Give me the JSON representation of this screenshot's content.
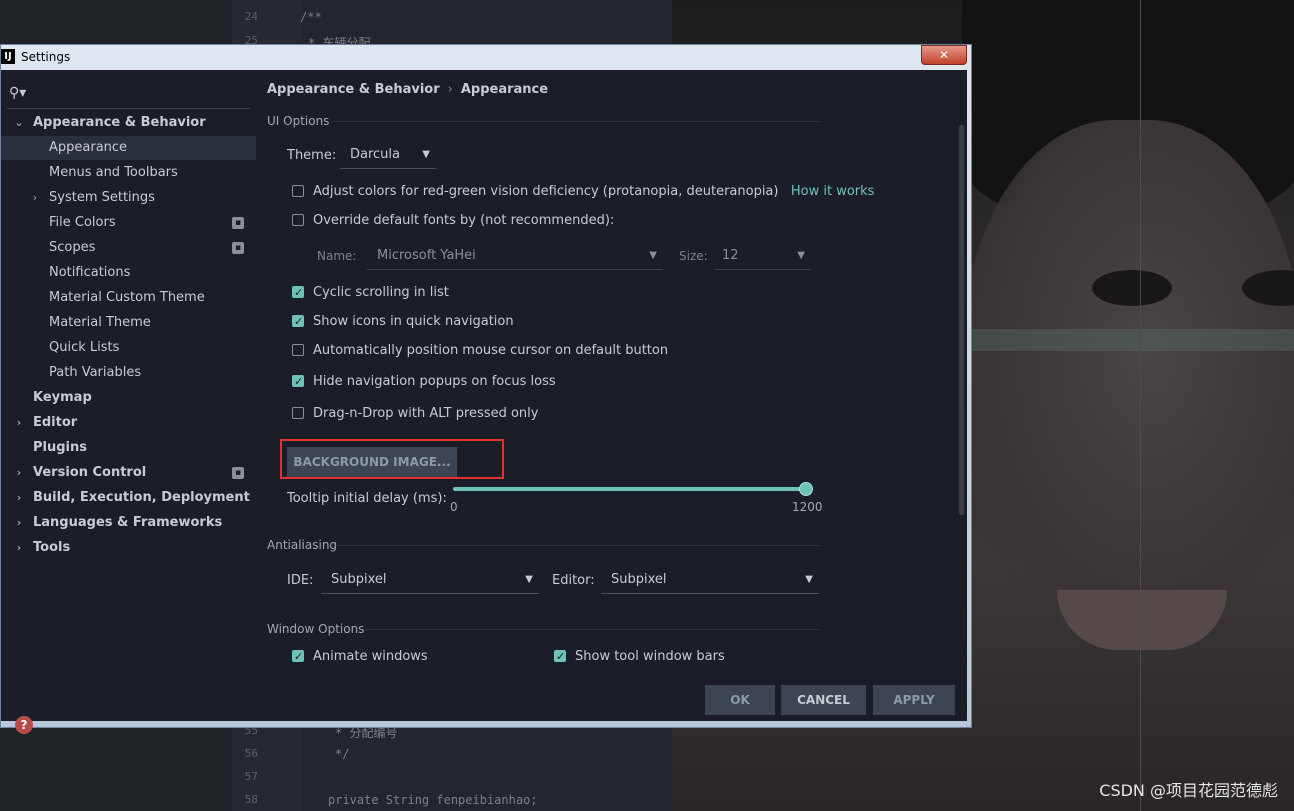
{
  "window": {
    "title": "Settings",
    "app_icon": "intellij-icon"
  },
  "search": {
    "icon": "search-icon"
  },
  "sidebar": {
    "items": [
      {
        "label": "Appearance & Behavior",
        "level": 0,
        "bold": true,
        "expanded": true
      },
      {
        "label": "Appearance",
        "level": 1,
        "selected": true
      },
      {
        "label": "Menus and Toolbars",
        "level": 1
      },
      {
        "label": "System Settings",
        "level": 1,
        "collapsed": true
      },
      {
        "label": "File Colors",
        "level": 1,
        "project_icon": true
      },
      {
        "label": "Scopes",
        "level": 1,
        "project_icon": true
      },
      {
        "label": "Notifications",
        "level": 1
      },
      {
        "label": "Material Custom Theme",
        "level": 1
      },
      {
        "label": "Material Theme",
        "level": 1
      },
      {
        "label": "Quick Lists",
        "level": 1
      },
      {
        "label": "Path Variables",
        "level": 1
      },
      {
        "label": "Keymap",
        "level": 0,
        "bold": true
      },
      {
        "label": "Editor",
        "level": 0,
        "bold": true,
        "collapsed": true
      },
      {
        "label": "Plugins",
        "level": 0,
        "bold": true
      },
      {
        "label": "Version Control",
        "level": 0,
        "bold": true,
        "collapsed": true,
        "project_icon": true
      },
      {
        "label": "Build, Execution, Deployment",
        "level": 0,
        "bold": true,
        "collapsed": true
      },
      {
        "label": "Languages & Frameworks",
        "level": 0,
        "bold": true,
        "collapsed": true
      },
      {
        "label": "Tools",
        "level": 0,
        "bold": true,
        "collapsed": true
      }
    ]
  },
  "breadcrumb": {
    "parent": "Appearance & Behavior",
    "separator": "›",
    "current": "Appearance"
  },
  "ui_options": {
    "section": "UI Options",
    "theme_label": "Theme:",
    "theme_value": "Darcula",
    "adjust_colors": {
      "label": "Adjust colors for red-green vision deficiency (protanopia, deuteranopia)",
      "checked": false
    },
    "how_it_works": "How it works",
    "override_fonts": {
      "label": "Override default fonts by (not recommended):",
      "checked": false
    },
    "font_name_label": "Name:",
    "font_name_value": "Microsoft YaHei",
    "font_size_label": "Size:",
    "font_size_value": "12",
    "cyclic_scrolling": {
      "label": "Cyclic scrolling in list",
      "checked": true
    },
    "show_icons": {
      "label": "Show icons in quick navigation",
      "checked": true
    },
    "auto_position": {
      "label": "Automatically position mouse cursor on default button",
      "checked": false
    },
    "hide_popups": {
      "label": "Hide navigation popups on focus loss",
      "checked": true
    },
    "drag_drop": {
      "label": "Drag-n-Drop with ALT pressed only",
      "checked": false
    },
    "background_image_button": "BACKGROUND IMAGE...",
    "tooltip_label": "Tooltip initial delay (ms):",
    "tooltip_min": "0",
    "tooltip_max": "1200",
    "tooltip_value": 1200
  },
  "antialiasing": {
    "section": "Antialiasing",
    "ide_label": "IDE:",
    "ide_value": "Subpixel",
    "editor_label": "Editor:",
    "editor_value": "Subpixel"
  },
  "window_options": {
    "section": "Window Options",
    "animate_windows": {
      "label": "Animate windows",
      "checked": true
    },
    "show_tool_window_bars": {
      "label": "Show tool window bars",
      "checked": true
    }
  },
  "buttons": {
    "ok": "OK",
    "cancel": "CANCEL",
    "apply": "APPLY"
  },
  "background_editor": {
    "gutter_lines": [
      "24",
      "25",
      "55",
      "56",
      "57",
      "58"
    ],
    "code_lines": [
      "/**",
      "* 车辆分配",
      "* 分配编号",
      "*/",
      "private String fenpeibianhao;"
    ]
  },
  "watermark": "CSDN @项目花园范德彪",
  "colors": {
    "accent": "#6fc2b6",
    "highlight_box": "#e03030",
    "panel_bg": "#1b1e26"
  }
}
